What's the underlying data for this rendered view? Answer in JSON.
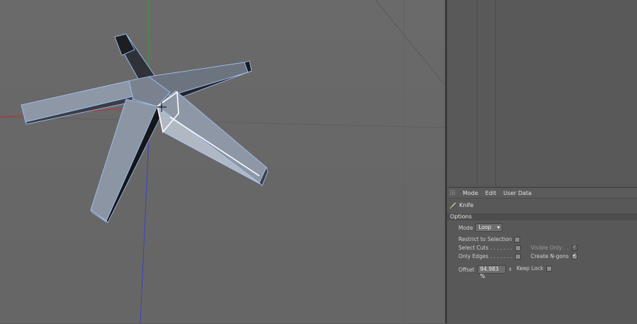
{
  "attributes": {
    "menu": {
      "mode": "Mode",
      "edit": "Edit",
      "user_data": "User Data"
    },
    "tool_name": "Knife",
    "section": "Options",
    "mode": {
      "label": "Mode",
      "value": "Loop"
    },
    "restrict_to_selection": {
      "label": "Restrict to Selection",
      "checked": false
    },
    "select_cuts": {
      "label": "Select Cuts . . . . . . .",
      "checked": false
    },
    "only_edges": {
      "label": "Only Edges . . . . . . .",
      "checked": false
    },
    "visible_only": {
      "label": "Visible Only . .",
      "checked": true,
      "enabled": false
    },
    "create_ngons": {
      "label": "Create N-gons",
      "checked": true
    },
    "offset": {
      "label": "Offset",
      "value": "94.983 %"
    },
    "keep_lock": {
      "label": "Keep Lock",
      "checked": false
    }
  },
  "colors": {
    "viewport_bg": "#686868",
    "axis_x": "#c03030",
    "axis_y": "#30a030",
    "axis_z": "#4040c0",
    "edge_highlight": "#a8c8ff",
    "cut_line": "#ffffff"
  },
  "icons": {
    "knife": "knife-icon",
    "grip": "grip-icon",
    "cursor": "crosshair-cursor-icon"
  }
}
